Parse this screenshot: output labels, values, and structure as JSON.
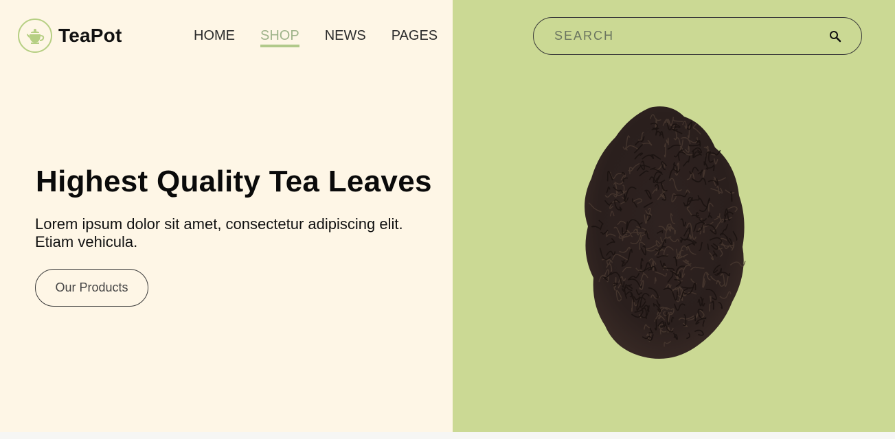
{
  "brand": {
    "name": "TeaPot",
    "logo_icon": "teapot-icon",
    "accent": "#b6cf83"
  },
  "nav": {
    "items": [
      {
        "label": "HOME",
        "active": false
      },
      {
        "label": "SHOP",
        "active": true
      },
      {
        "label": "NEWS",
        "active": false
      },
      {
        "label": "PAGES",
        "active": false
      }
    ]
  },
  "search": {
    "placeholder": "SEARCH",
    "icon": "search-icon"
  },
  "hero": {
    "title": "Highest Quality Tea Leaves",
    "text": "Lorem ipsum dolor sit amet, consectetur adipiscing elit. Etiam vehicula.",
    "cta_label": "Our Products",
    "image": "tea-leaves-image"
  },
  "colors": {
    "left_bg": "#fef6e6",
    "right_bg": "#cbd994",
    "nav_active": "#9fb38a"
  }
}
